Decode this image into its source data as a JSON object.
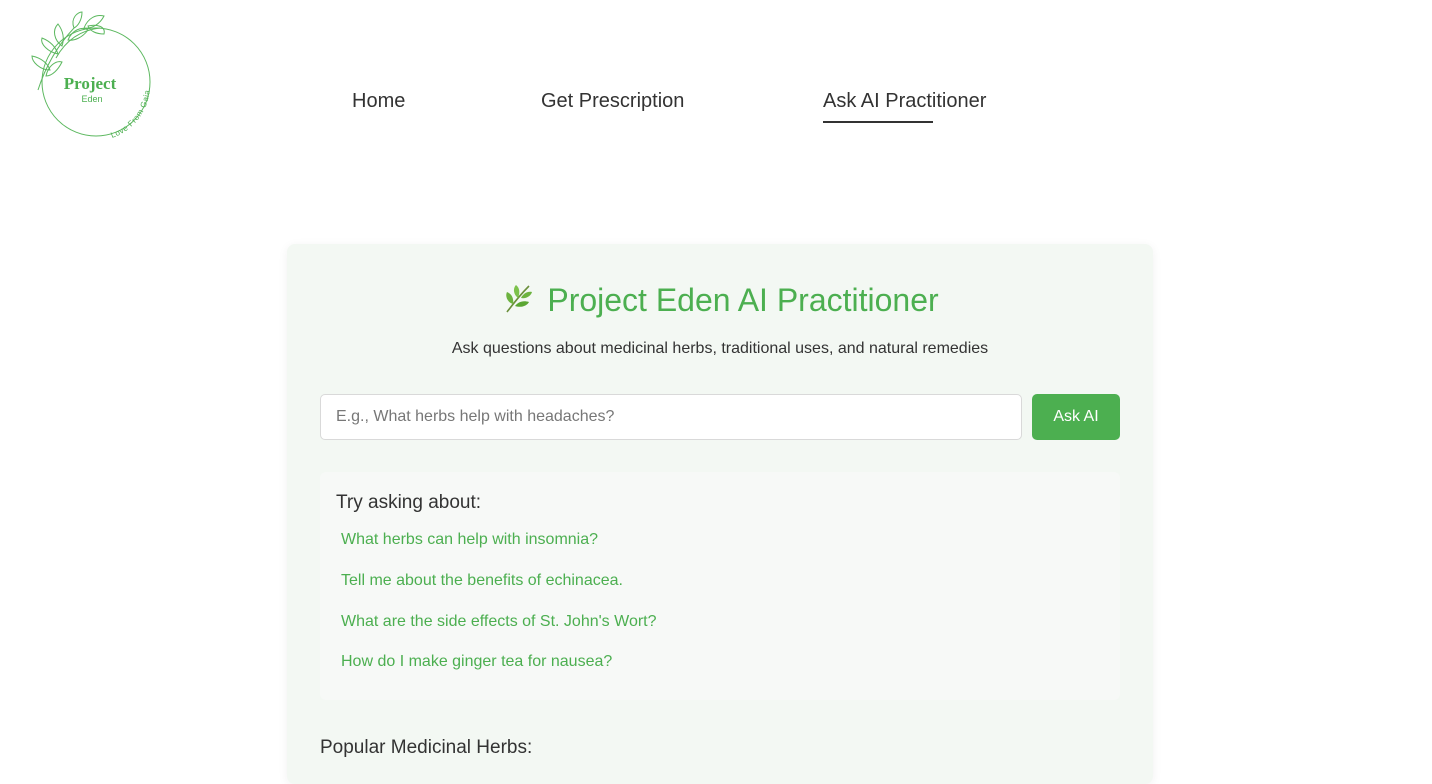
{
  "logo": {
    "title": "Project",
    "subtitle": "Eden",
    "tagline": "Love From Gaia",
    "icon": "leaf-branch-icon",
    "color": "#4caf50"
  },
  "nav": {
    "items": [
      {
        "label": "Home"
      },
      {
        "label": "Get Prescription"
      },
      {
        "label": "Ask AI Practitioner",
        "active": true
      }
    ]
  },
  "main": {
    "title_icon": "herb-leaf-icon",
    "title": "Project Eden AI Practitioner",
    "subtitle": "Ask questions about medicinal herbs, traditional uses, and natural remedies",
    "search": {
      "placeholder": "E.g., What herbs help with headaches?",
      "value": ""
    },
    "ask_button": "Ask AI",
    "suggestions": {
      "title": "Try asking about:",
      "items": [
        "What herbs can help with insomnia?",
        "Tell me about the benefits of echinacea.",
        "What are the side effects of St. John's Wort?",
        "How do I make ginger tea for nausea?"
      ]
    },
    "popular_title": "Popular Medicinal Herbs:"
  },
  "colors": {
    "accent": "#4caf50",
    "card_background": "#f3f8f3",
    "text": "#333333"
  }
}
